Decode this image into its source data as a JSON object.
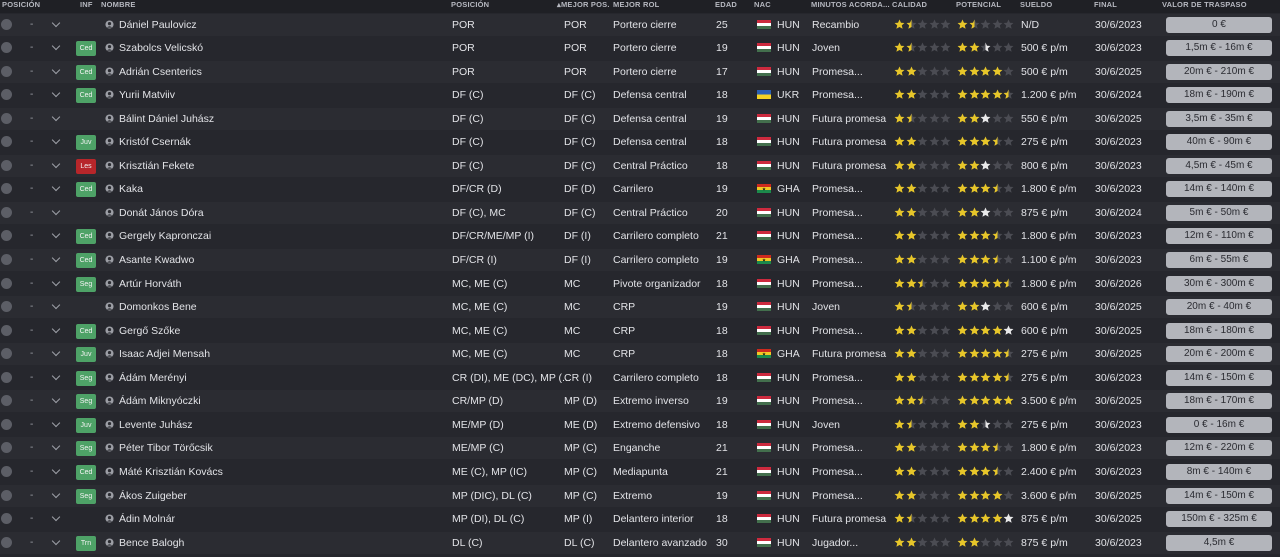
{
  "columns": {
    "posicion_left": "POSICIÓN",
    "inf": "INF",
    "nombre": "NOMBRE",
    "posicion": "POSICIÓN",
    "mejor_pos": "MEJOR POS.",
    "mejor_rol": "MEJOR ROL",
    "edad": "EDAD",
    "nac": "NAC",
    "minutos": "MINUTOS ACORDA...",
    "calidad": "CALIDAD",
    "potencial": "POTENCIAL",
    "sueldo": "SUELDO",
    "final": "FINAL",
    "valor": "VALOR DE TRASPASO"
  },
  "colors": {
    "star_filled": "#e7c62a",
    "star_empty": "#4b4c53",
    "star_white": "#e9e9ea",
    "badge_green": "#4ea267",
    "badge_red": "#b7262a"
  },
  "players": [
    {
      "pos_mark": "-",
      "inf": "",
      "name": "Dániel Paulovicz",
      "posicion": "POR",
      "mejor_pos": "POR",
      "rol": "Portero cierre",
      "edad": "25",
      "flag": "HUN",
      "nac": "HUN",
      "minutos": "Recambio",
      "calidad": 1.5,
      "potencial": 1.5,
      "pot_extra": 0,
      "sueldo": "N/D",
      "final": "30/6/2023",
      "valor": "0 €"
    },
    {
      "pos_mark": "-",
      "inf": "Ced",
      "name": "Szabolcs Velicskó",
      "posicion": "POR",
      "mejor_pos": "POR",
      "rol": "Portero cierre",
      "edad": "19",
      "flag": "HUN",
      "nac": "HUN",
      "minutos": "Joven",
      "calidad": 1.5,
      "potencial": 2,
      "pot_extra": 0.5,
      "sueldo": "500 € p/m",
      "final": "30/6/2023",
      "valor": "1,5m € - 16m €"
    },
    {
      "pos_mark": "-",
      "inf": "Ced",
      "name": "Adrián Csenterics",
      "posicion": "POR",
      "mejor_pos": "POR",
      "rol": "Portero cierre",
      "edad": "17",
      "flag": "HUN",
      "nac": "HUN",
      "minutos": "Promesa...",
      "calidad": 2,
      "potencial": 4,
      "pot_extra": 0,
      "sueldo": "500 € p/m",
      "final": "30/6/2025",
      "valor": "20m € - 210m €"
    },
    {
      "pos_mark": "-",
      "inf": "Ced",
      "name": "Yurii Matviiv",
      "posicion": "DF (C)",
      "mejor_pos": "DF (C)",
      "rol": "Defensa central",
      "edad": "18",
      "flag": "UKR",
      "nac": "UKR",
      "minutos": "Promesa...",
      "calidad": 2,
      "potencial": 4.5,
      "pot_extra": 0,
      "sueldo": "1.200 € p/m",
      "final": "30/6/2024",
      "valor": "18m € - 190m €"
    },
    {
      "pos_mark": "-",
      "inf": "",
      "name": "Bálint Dániel Juhász",
      "posicion": "DF (C)",
      "mejor_pos": "DF (C)",
      "rol": "Defensa central",
      "edad": "19",
      "flag": "HUN",
      "nac": "HUN",
      "minutos": "Futura promesa",
      "calidad": 1.5,
      "potencial": 2,
      "pot_extra": 1,
      "sueldo": "550 € p/m",
      "final": "30/6/2025",
      "valor": "3,5m € - 35m €"
    },
    {
      "pos_mark": "-",
      "inf": "Juv",
      "name": "Kristóf Csernák",
      "posicion": "DF (C)",
      "mejor_pos": "DF (C)",
      "rol": "Defensa central",
      "edad": "18",
      "flag": "HUN",
      "nac": "HUN",
      "minutos": "Futura promesa",
      "calidad": 2,
      "potencial": 3.5,
      "pot_extra": 0,
      "sueldo": "275 € p/m",
      "final": "30/6/2023",
      "valor": "40m € - 90m €"
    },
    {
      "pos_mark": "-",
      "inf": "Les",
      "name": "Krisztián Fekete",
      "posicion": "DF (C)",
      "mejor_pos": "DF (C)",
      "rol": "Central Práctico",
      "edad": "18",
      "flag": "HUN",
      "nac": "HUN",
      "minutos": "Futura promesa",
      "calidad": 2,
      "potencial": 2,
      "pot_extra": 1,
      "sueldo": "800 € p/m",
      "final": "30/6/2023",
      "valor": "4,5m € - 45m €"
    },
    {
      "pos_mark": "-",
      "inf": "Ced",
      "name": "Kaka",
      "posicion": "DF/CR (D)",
      "mejor_pos": "DF (D)",
      "rol": "Carrilero",
      "edad": "19",
      "flag": "GHA",
      "nac": "GHA",
      "minutos": "Promesa...",
      "calidad": 2,
      "potencial": 3.5,
      "pot_extra": 0,
      "sueldo": "1.800 € p/m",
      "final": "30/6/2023",
      "valor": "14m € - 140m €"
    },
    {
      "pos_mark": "-",
      "inf": "",
      "name": "Donát János Dóra",
      "posicion": "DF (C), MC",
      "mejor_pos": "DF (C)",
      "rol": "Central Práctico",
      "edad": "20",
      "flag": "HUN",
      "nac": "HUN",
      "minutos": "Promesa...",
      "calidad": 2,
      "potencial": 2,
      "pot_extra": 1,
      "sueldo": "875 € p/m",
      "final": "30/6/2024",
      "valor": "5m € - 50m €"
    },
    {
      "pos_mark": "-",
      "inf": "Ced",
      "name": "Gergely Kapronczai",
      "posicion": "DF/CR/ME/MP (I)",
      "mejor_pos": "DF (I)",
      "rol": "Carrilero completo",
      "edad": "21",
      "flag": "HUN",
      "nac": "HUN",
      "minutos": "Promesa...",
      "calidad": 2,
      "potencial": 3.5,
      "pot_extra": 0,
      "sueldo": "1.800 € p/m",
      "final": "30/6/2023",
      "valor": "12m € - 110m €"
    },
    {
      "pos_mark": "-",
      "inf": "Ced",
      "name": "Asante Kwadwo",
      "posicion": "DF/CR (I)",
      "mejor_pos": "DF (I)",
      "rol": "Carrilero completo",
      "edad": "19",
      "flag": "GHA",
      "nac": "GHA",
      "minutos": "Promesa...",
      "calidad": 2,
      "potencial": 3.5,
      "pot_extra": 0,
      "sueldo": "1.100 € p/m",
      "final": "30/6/2023",
      "valor": "6m € - 55m €"
    },
    {
      "pos_mark": "-",
      "inf": "Seg",
      "name": "Artúr Horváth",
      "posicion": "MC, ME (C)",
      "mejor_pos": "MC",
      "rol": "Pivote organizador",
      "edad": "18",
      "flag": "HUN",
      "nac": "HUN",
      "minutos": "Promesa...",
      "calidad": 2.5,
      "potencial": 4.5,
      "pot_extra": 0,
      "sueldo": "1.800 € p/m",
      "final": "30/6/2026",
      "valor": "30m € - 300m €"
    },
    {
      "pos_mark": "-",
      "inf": "",
      "name": "Domonkos Bene",
      "posicion": "MC, ME (C)",
      "mejor_pos": "MC",
      "rol": "CRP",
      "edad": "19",
      "flag": "HUN",
      "nac": "HUN",
      "minutos": "Joven",
      "calidad": 1.5,
      "potencial": 2,
      "pot_extra": 1,
      "sueldo": "600 € p/m",
      "final": "30/6/2025",
      "valor": "20m € - 40m €"
    },
    {
      "pos_mark": "-",
      "inf": "Ced",
      "name": "Gergő Szőke",
      "posicion": "MC, ME (C)",
      "mejor_pos": "MC",
      "rol": "CRP",
      "edad": "18",
      "flag": "HUN",
      "nac": "HUN",
      "minutos": "Promesa...",
      "calidad": 2,
      "potencial": 4,
      "pot_extra": 1,
      "sueldo": "600 € p/m",
      "final": "30/6/2025",
      "valor": "18m € - 180m €"
    },
    {
      "pos_mark": "-",
      "inf": "Juv",
      "name": "Isaac Adjei Mensah",
      "posicion": "MC, ME (C)",
      "mejor_pos": "MC",
      "rol": "CRP",
      "edad": "18",
      "flag": "GHA",
      "nac": "GHA",
      "minutos": "Futura promesa",
      "calidad": 2,
      "potencial": 4.5,
      "pot_extra": 0,
      "sueldo": "275 € p/m",
      "final": "30/6/2025",
      "valor": "20m € - 200m €"
    },
    {
      "pos_mark": "-",
      "inf": "Seg",
      "name": "Ádám Merényi",
      "posicion": "CR (DI), ME (DC), MP (...",
      "mejor_pos": "CR (I)",
      "rol": "Carrilero completo",
      "edad": "18",
      "flag": "HUN",
      "nac": "HUN",
      "minutos": "Promesa...",
      "calidad": 2,
      "potencial": 4.5,
      "pot_extra": 0,
      "sueldo": "275 € p/m",
      "final": "30/6/2023",
      "valor": "14m € - 150m €"
    },
    {
      "pos_mark": "-",
      "inf": "Seg",
      "name": "Ádám Miknyóczki",
      "posicion": "CR/MP (D)",
      "mejor_pos": "MP (D)",
      "rol": "Extremo inverso",
      "edad": "19",
      "flag": "HUN",
      "nac": "HUN",
      "minutos": "Promesa...",
      "calidad": 2.5,
      "potencial": 5,
      "pot_extra": 0,
      "sueldo": "3.500 € p/m",
      "final": "30/6/2025",
      "valor": "18m € - 170m €"
    },
    {
      "pos_mark": "-",
      "inf": "Juv",
      "name": "Levente Juhász",
      "posicion": "ME/MP (D)",
      "mejor_pos": "ME (D)",
      "rol": "Extremo defensivo",
      "edad": "18",
      "flag": "HUN",
      "nac": "HUN",
      "minutos": "Joven",
      "calidad": 1.5,
      "potencial": 2,
      "pot_extra": 0.5,
      "sueldo": "275 € p/m",
      "final": "30/6/2023",
      "valor": "0 € - 16m €"
    },
    {
      "pos_mark": "-",
      "inf": "Seg",
      "name": "Péter Tibor Törőcsik",
      "posicion": "ME/MP (C)",
      "mejor_pos": "MP (C)",
      "rol": "Enganche",
      "edad": "21",
      "flag": "HUN",
      "nac": "HUN",
      "minutos": "Promesa...",
      "calidad": 2,
      "potencial": 3.5,
      "pot_extra": 0,
      "sueldo": "1.800 € p/m",
      "final": "30/6/2023",
      "valor": "12m € - 220m €"
    },
    {
      "pos_mark": "-",
      "inf": "Ced",
      "name": "Máté Krisztián Kovács",
      "posicion": "ME (C), MP (IC)",
      "mejor_pos": "MP (C)",
      "rol": "Mediapunta",
      "edad": "21",
      "flag": "HUN",
      "nac": "HUN",
      "minutos": "Promesa...",
      "calidad": 2,
      "potencial": 3.5,
      "pot_extra": 0,
      "sueldo": "2.400 € p/m",
      "final": "30/6/2023",
      "valor": "8m € - 140m €"
    },
    {
      "pos_mark": "-",
      "inf": "Seg",
      "name": "Ákos Zuigeber",
      "posicion": "MP (DIC), DL (C)",
      "mejor_pos": "MP (C)",
      "rol": "Extremo",
      "edad": "19",
      "flag": "HUN",
      "nac": "HUN",
      "minutos": "Promesa...",
      "calidad": 2,
      "potencial": 4,
      "pot_extra": 0,
      "sueldo": "3.600 € p/m",
      "final": "30/6/2025",
      "valor": "14m € - 150m €"
    },
    {
      "pos_mark": "-",
      "inf": "",
      "name": "Ádin Molnár",
      "posicion": "MP (DI), DL (C)",
      "mejor_pos": "MP (I)",
      "rol": "Delantero interior",
      "edad": "18",
      "flag": "HUN",
      "nac": "HUN",
      "minutos": "Futura promesa",
      "calidad": 1.5,
      "potencial": 4,
      "pot_extra": 1,
      "sueldo": "875 € p/m",
      "final": "30/6/2025",
      "valor": "150m € - 325m €"
    },
    {
      "pos_mark": "-",
      "inf": "Trn",
      "name": "Bence Balogh",
      "posicion": "DL (C)",
      "mejor_pos": "DL (C)",
      "rol": "Delantero avanzado",
      "edad": "30",
      "flag": "HUN",
      "nac": "HUN",
      "minutos": "Jugador...",
      "calidad": 2,
      "potencial": 2,
      "pot_extra": 0,
      "sueldo": "875 € p/m",
      "final": "30/6/2023",
      "valor": "4,5m €"
    }
  ]
}
